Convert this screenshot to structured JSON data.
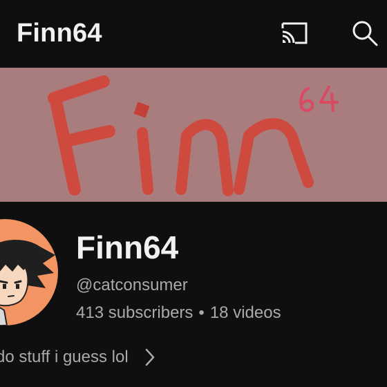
{
  "topbar": {
    "title": "Finn64",
    "icons": [
      "cast-icon",
      "search-icon"
    ]
  },
  "banner": {
    "logo_text": "Finn",
    "logo_superscript": "64",
    "background_color": "#a97c7d",
    "logo_color": "#cf4a3e",
    "superscript_color": "#d94a62"
  },
  "channel": {
    "name": "Finn64",
    "handle": "@catconsumer",
    "subscribers": "413 subscribers",
    "separator": "•",
    "videos": "18 videos",
    "description": "do stuff i guess lol",
    "avatar_bg": "#f29563"
  },
  "colors": {
    "background": "#0f0f0f",
    "text_primary": "#f1f1f1",
    "text_secondary": "#aaaaaa"
  }
}
